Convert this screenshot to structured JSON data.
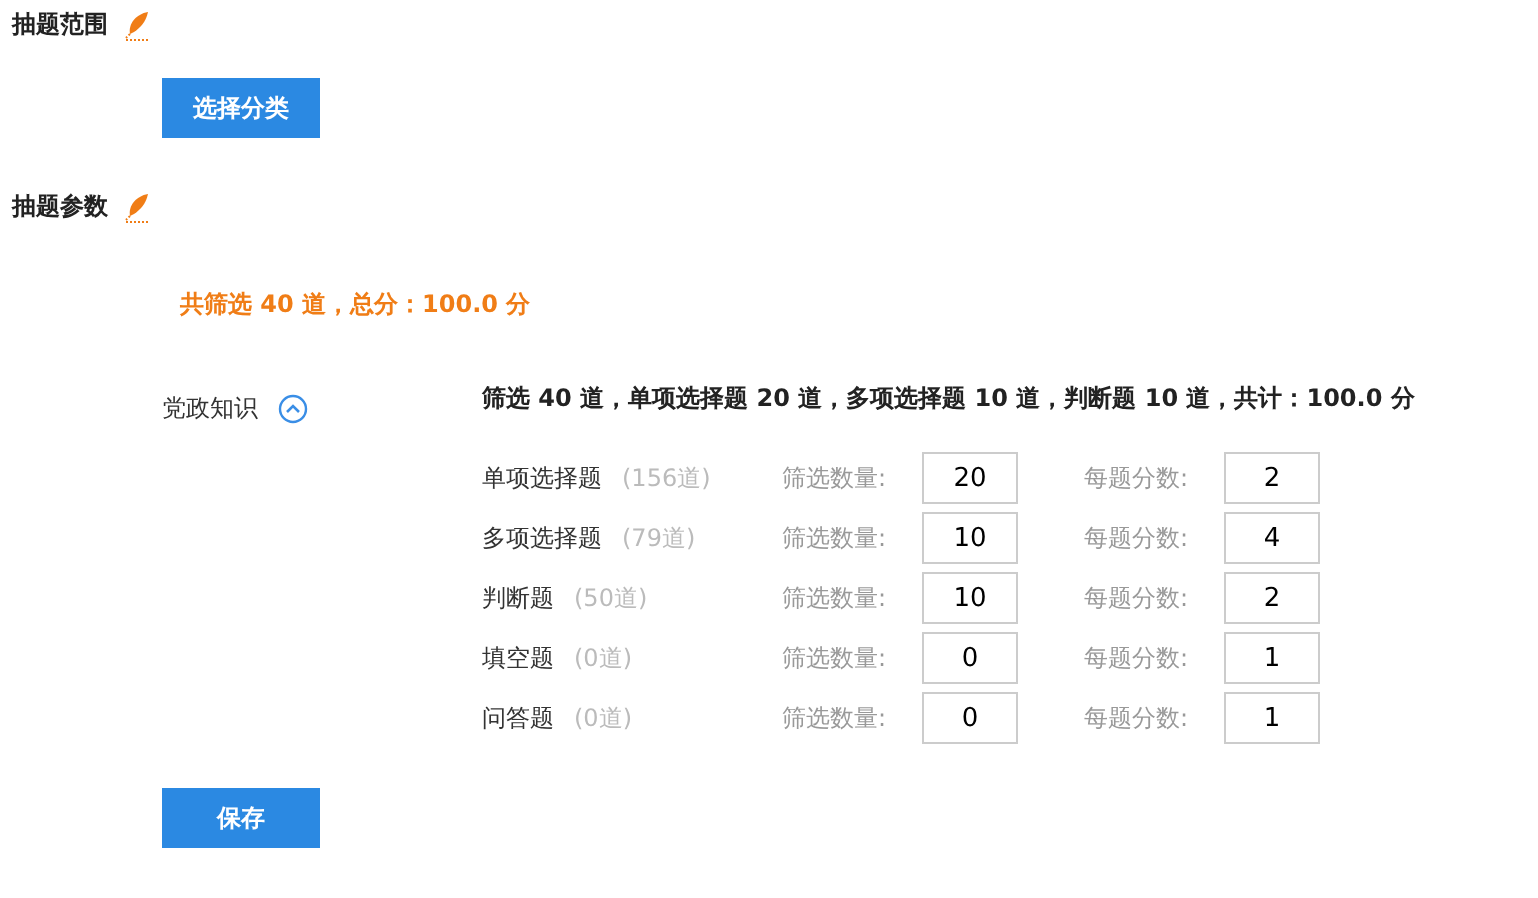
{
  "sections": [
    {
      "title": "抽题范围"
    },
    {
      "title": "抽题参数"
    }
  ],
  "select_button": "选择分类",
  "total_summary": "共筛选 40 道，总分：100.0 分",
  "category": {
    "name": "党政知识",
    "expanded": true,
    "summary": "筛选 40 道，单项选择题 20 道，多项选择题 10 道，判断题 10 道，共计：100.0 分",
    "rows": [
      {
        "type": "单项选择题",
        "available": "(156道)",
        "count_label": "筛选数量:",
        "count": "20",
        "score_label": "每题分数:",
        "score": "2"
      },
      {
        "type": "多项选择题",
        "available": "(79道)",
        "count_label": "筛选数量:",
        "count": "10",
        "score_label": "每题分数:",
        "score": "4"
      },
      {
        "type": "判断题",
        "available": "(50道)",
        "count_label": "筛选数量:",
        "count": "10",
        "score_label": "每题分数:",
        "score": "2"
      },
      {
        "type": "填空题",
        "available": "(0道)",
        "count_label": "筛选数量:",
        "count": "0",
        "score_label": "每题分数:",
        "score": "1"
      },
      {
        "type": "问答题",
        "available": "(0道)",
        "count_label": "筛选数量:",
        "count": "0",
        "score_label": "每题分数:",
        "score": "1"
      }
    ]
  },
  "save_button": "保存"
}
